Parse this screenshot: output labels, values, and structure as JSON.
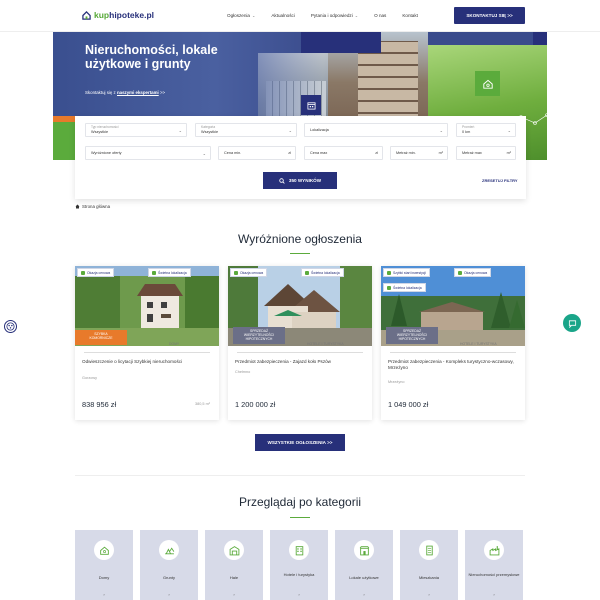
{
  "header": {
    "logo_prefix": "kup",
    "logo_main": "hipoteke",
    "logo_suffix": ".pl",
    "nav": [
      {
        "label": "Ogłoszenia",
        "has_dropdown": true
      },
      {
        "label": "Aktualności",
        "has_dropdown": false
      },
      {
        "label": "Pytania i odpowiedzi",
        "has_dropdown": true
      },
      {
        "label": "O nas",
        "has_dropdown": false
      },
      {
        "label": "Kontakt",
        "has_dropdown": false
      }
    ],
    "contact_button": "SKONTAKTUJ SIĘ >>"
  },
  "hero": {
    "title": "Nieruchomości, lokale użytkowe i grunty",
    "subtitle_prefix": "Skontaktuj się z",
    "subtitle_link": "naszymi ekspertami",
    "subtitle_suffix": ">>"
  },
  "search": {
    "fields": {
      "property_type": {
        "label": "Typ nieruchomości",
        "value": "Wszystkie"
      },
      "category": {
        "label": "Kategoria",
        "value": "Wszystkie"
      },
      "location": {
        "placeholder": "Lokalizacja"
      },
      "radius": {
        "label": "Promień",
        "value": "0 km"
      },
      "offer_side": {
        "placeholder": "Wyróżnione oferty"
      },
      "price_min": {
        "placeholder": "Cena min.",
        "unit": "zł"
      },
      "price_max": {
        "placeholder": "Cena max",
        "unit": "zł"
      },
      "area_min": {
        "placeholder": "Metraż min.",
        "unit": "m²"
      },
      "area_max": {
        "placeholder": "Metraż max",
        "unit": "m²"
      }
    },
    "submit_label": "350 WYNIKÓW",
    "reset_label": "ZRESETUJ FILTRY"
  },
  "breadcrumb": "Strona główna",
  "featured": {
    "title": "Wyróżnione ogłoszenia",
    "cards": [
      {
        "tags": [
          "Okazja cenowa",
          "Świetna lokalizacja"
        ],
        "badge": "SZYBKA\nKOMORNICZE",
        "type": "DOMY",
        "title": "Odwieszczenie o licytacji Szybkiej nieruchomości",
        "location": "Gorzowy",
        "price": "838 956 zł",
        "area": "380,5 m²"
      },
      {
        "tags": [
          "Okazja cenowa",
          "Świetna lokalizacja"
        ],
        "badge": "SPRZEDAŻ\nWIERZYTELNOŚCI\nHIPOTECZNYCH",
        "type": "HOTELE I TURYSTYKA",
        "title": "Przedmiot zabezpieczenia - Zajazd koło Pszów",
        "location": "Chełmno",
        "price": "1 200 000 zł",
        "area": ""
      },
      {
        "tags": [
          "Szybki start inwestycji",
          "Okazja cenowa",
          "Świetna lokalizacja"
        ],
        "badge": "SPRZEDAŻ\nWIERZYTELNOŚCI\nHIPOTECZNYCH",
        "type": "HOTELE I TURYSTYKA",
        "title": "Przedmiot zabezpieczenia - Kompleks turystyczno-wczasowy, Mrzeżyno",
        "location": "Mrzeżyno",
        "price": "1 049 000 zł",
        "area": ""
      }
    ],
    "all_button": "WSZYSTKIE OGŁOSZENIA >>"
  },
  "categories": {
    "title": "Przeglądaj po kategorii",
    "items": [
      {
        "label": "Domy",
        "arrow": "›"
      },
      {
        "label": "Grunty",
        "arrow": "›"
      },
      {
        "label": "Hale",
        "arrow": "›"
      },
      {
        "label": "Hotele i turystyka",
        "arrow": "›"
      },
      {
        "label": "Lokale użytkowe",
        "arrow": "›"
      },
      {
        "label": "Mieszkania",
        "arrow": "›"
      },
      {
        "label": "Nieruchomości przemysłowe",
        "arrow": "›"
      }
    ]
  },
  "colors": {
    "navy": "#27307a",
    "green": "#5bab3c",
    "orange": "#e87a2b",
    "teal": "#1aa589"
  }
}
